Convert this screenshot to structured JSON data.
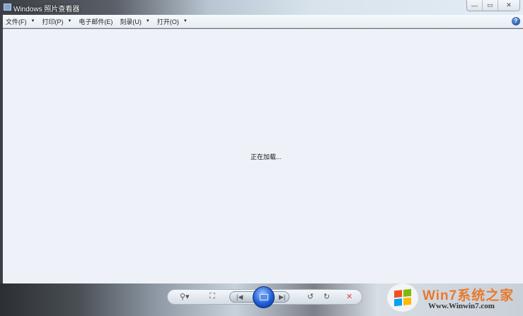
{
  "window": {
    "title": "Windows 照片查看器",
    "minimize": "—",
    "restore": "▭",
    "close": "✕"
  },
  "menu": [
    {
      "label": "文件(F)"
    },
    {
      "label": "打印(P)"
    },
    {
      "label": "电子邮件(E)"
    },
    {
      "label": "刻录(U)"
    },
    {
      "label": "打开(O)"
    }
  ],
  "help": "?",
  "status": "正在加载...",
  "controls": {
    "zoom": "⚲▾",
    "fit": "⛶",
    "prev": "|◀",
    "next": "▶|",
    "rotate_ccw": "↺",
    "rotate_cw": "↻",
    "delete": "✕"
  },
  "watermark": {
    "title": "Win7系统之家",
    "url": "Www.Winwin7.com"
  },
  "colors": {
    "flag": [
      "#f25022",
      "#7fba00",
      "#00a4ef",
      "#ffb900"
    ]
  }
}
